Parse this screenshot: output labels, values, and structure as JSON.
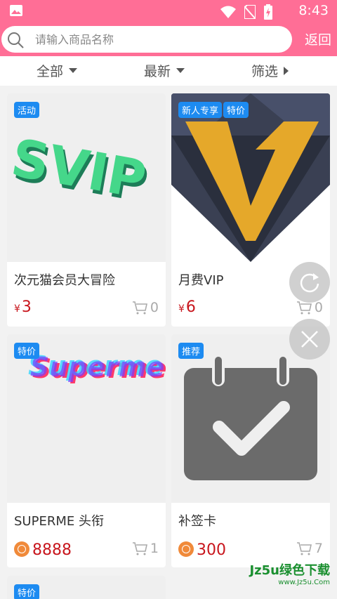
{
  "status_bar": {
    "time": "8:43"
  },
  "header": {
    "search_placeholder": "请输入商品名称",
    "back_label": "返回"
  },
  "filters": [
    {
      "label": "全部",
      "arrow": "down"
    },
    {
      "label": "最新",
      "arrow": "down"
    },
    {
      "label": "筛选",
      "arrow": "right"
    }
  ],
  "products": [
    {
      "name": "次元猫会员大冒险",
      "tags": [
        "活动"
      ],
      "price_type": "yen",
      "currency": "¥",
      "price": "3",
      "cart_count": "0",
      "image_text": "SVIP"
    },
    {
      "name": "月费VIP",
      "tags": [
        "新人专享",
        "特价"
      ],
      "price_type": "yen",
      "currency": "¥",
      "price": "6",
      "cart_count": "0"
    },
    {
      "name": "SUPERME 头衔",
      "tags": [
        "特价"
      ],
      "price_type": "coin",
      "price": "8888",
      "cart_count": "1",
      "image_text": "Superme"
    },
    {
      "name": "补签卡",
      "tags": [
        "推荐"
      ],
      "price_type": "coin",
      "price": "300",
      "cart_count": "7"
    },
    {
      "name": "",
      "tags": [
        "特价"
      ]
    }
  ],
  "watermark": {
    "line1": "Jz5u绿色下载",
    "line2": "www.Jz5u.Com"
  },
  "colors": {
    "brand": "#ff6e96",
    "tag": "#1d8bf1",
    "price": "#c8161d",
    "coin": "#f08a3a"
  }
}
